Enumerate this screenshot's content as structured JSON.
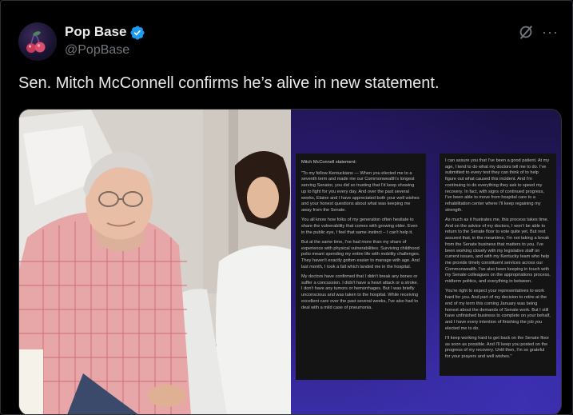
{
  "author": {
    "name": "Pop Base",
    "handle": "@PopBase",
    "verified": true,
    "verified_color": "#1d9bf0"
  },
  "post": {
    "text": "Sen. Mitch McConnell confirms he’s alive in new statement."
  },
  "actions": {
    "grok_icon": "grok-icon",
    "more_label": "···"
  },
  "media": {
    "photo_icon": "photo",
    "statement": {
      "title": "Mitch McConnell statement:",
      "left_paragraphs": [
        "\"To my fellow Kentuckians — When you elected me to a seventh term and made me our Commonwealth's longest serving Senator, you did so trusting that I'd keep showing up to fight for you every day. And over the past several weeks, Elaine and I have appreciated both your well wishes and your honest questions about what was keeping me away from the Senate.",
        "You all know how folks of my generation often hesitate to share the vulnerability that comes with growing older. Even in the public eye, I feel that same instinct – I can't help it.",
        "But at the same time, I've had more than my share of experience with physical vulnerabilities. Surviving childhood polio meant spending my entire life with mobility challenges. They haven't exactly gotten easier to manage with age. And last month, I took a fall which landed me in the hospital.",
        "My doctors have confirmed that I didn't break any bones or suffer a concussion. I didn't have a heart attack or a stroke. I don't have any tumors or hemorrhages. But I was briefly unconscious and was taken to the hospital. While receiving excellent care over the past several weeks, I've also had to deal with a mild case of pneumonia."
      ],
      "right_paragraphs": [
        "I can assure you that I've been a good patient. At my age, I tend to do what my doctors tell me to do. I've submitted to every test they can think of to help figure out what caused this incident. And I'm continuing to do everything they ask to speed my recovery. In fact, with signs of continued progress, I've been able to move from hospital care to a rehabilitation center where I'll keep regaining my strength.",
        "As much as it frustrates me, this process takes time. And on the advice of my doctors, I won't be able to return to the Senate floor to vote quite yet. But rest assured that, in the meantime, I'm not taking a break from the Senate business that matters to you. I've been working closely with my legislative staff on current issues, and with my Kentucky team who help me provide timely constituent services across our Commonwealth. I've also been keeping in touch with my Senate colleagues on the appropriations process, midterm politics, and everything in between.",
        "You're right to expect your representatives to work hard for you. And part of my decision to retire at the end of my term this coming January was being honest about the demands of Senate work. But I still have unfinished business to complete on your behalf, and I have every intention of finishing the job you elected me to do.",
        "I'll keep working hard to get back on the Senate floor as soon as possible. And I'll keep you posted on the progress of my recovery. Until then, I'm so grateful for your prayers and well wishes.\""
      ]
    }
  }
}
